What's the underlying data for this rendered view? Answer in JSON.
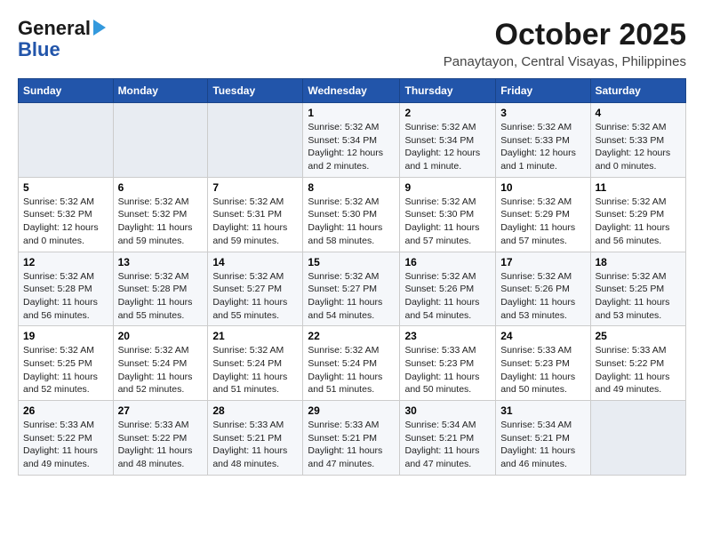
{
  "header": {
    "logo_line1": "General",
    "logo_line2": "Blue",
    "month": "October 2025",
    "location": "Panaytayon, Central Visayas, Philippines"
  },
  "days_of_week": [
    "Sunday",
    "Monday",
    "Tuesday",
    "Wednesday",
    "Thursday",
    "Friday",
    "Saturday"
  ],
  "weeks": [
    [
      {
        "day": "",
        "info": ""
      },
      {
        "day": "",
        "info": ""
      },
      {
        "day": "",
        "info": ""
      },
      {
        "day": "1",
        "info": "Sunrise: 5:32 AM\nSunset: 5:34 PM\nDaylight: 12 hours\nand 2 minutes."
      },
      {
        "day": "2",
        "info": "Sunrise: 5:32 AM\nSunset: 5:34 PM\nDaylight: 12 hours\nand 1 minute."
      },
      {
        "day": "3",
        "info": "Sunrise: 5:32 AM\nSunset: 5:33 PM\nDaylight: 12 hours\nand 1 minute."
      },
      {
        "day": "4",
        "info": "Sunrise: 5:32 AM\nSunset: 5:33 PM\nDaylight: 12 hours\nand 0 minutes."
      }
    ],
    [
      {
        "day": "5",
        "info": "Sunrise: 5:32 AM\nSunset: 5:32 PM\nDaylight: 12 hours\nand 0 minutes."
      },
      {
        "day": "6",
        "info": "Sunrise: 5:32 AM\nSunset: 5:32 PM\nDaylight: 11 hours\nand 59 minutes."
      },
      {
        "day": "7",
        "info": "Sunrise: 5:32 AM\nSunset: 5:31 PM\nDaylight: 11 hours\nand 59 minutes."
      },
      {
        "day": "8",
        "info": "Sunrise: 5:32 AM\nSunset: 5:30 PM\nDaylight: 11 hours\nand 58 minutes."
      },
      {
        "day": "9",
        "info": "Sunrise: 5:32 AM\nSunset: 5:30 PM\nDaylight: 11 hours\nand 57 minutes."
      },
      {
        "day": "10",
        "info": "Sunrise: 5:32 AM\nSunset: 5:29 PM\nDaylight: 11 hours\nand 57 minutes."
      },
      {
        "day": "11",
        "info": "Sunrise: 5:32 AM\nSunset: 5:29 PM\nDaylight: 11 hours\nand 56 minutes."
      }
    ],
    [
      {
        "day": "12",
        "info": "Sunrise: 5:32 AM\nSunset: 5:28 PM\nDaylight: 11 hours\nand 56 minutes."
      },
      {
        "day": "13",
        "info": "Sunrise: 5:32 AM\nSunset: 5:28 PM\nDaylight: 11 hours\nand 55 minutes."
      },
      {
        "day": "14",
        "info": "Sunrise: 5:32 AM\nSunset: 5:27 PM\nDaylight: 11 hours\nand 55 minutes."
      },
      {
        "day": "15",
        "info": "Sunrise: 5:32 AM\nSunset: 5:27 PM\nDaylight: 11 hours\nand 54 minutes."
      },
      {
        "day": "16",
        "info": "Sunrise: 5:32 AM\nSunset: 5:26 PM\nDaylight: 11 hours\nand 54 minutes."
      },
      {
        "day": "17",
        "info": "Sunrise: 5:32 AM\nSunset: 5:26 PM\nDaylight: 11 hours\nand 53 minutes."
      },
      {
        "day": "18",
        "info": "Sunrise: 5:32 AM\nSunset: 5:25 PM\nDaylight: 11 hours\nand 53 minutes."
      }
    ],
    [
      {
        "day": "19",
        "info": "Sunrise: 5:32 AM\nSunset: 5:25 PM\nDaylight: 11 hours\nand 52 minutes."
      },
      {
        "day": "20",
        "info": "Sunrise: 5:32 AM\nSunset: 5:24 PM\nDaylight: 11 hours\nand 52 minutes."
      },
      {
        "day": "21",
        "info": "Sunrise: 5:32 AM\nSunset: 5:24 PM\nDaylight: 11 hours\nand 51 minutes."
      },
      {
        "day": "22",
        "info": "Sunrise: 5:32 AM\nSunset: 5:24 PM\nDaylight: 11 hours\nand 51 minutes."
      },
      {
        "day": "23",
        "info": "Sunrise: 5:33 AM\nSunset: 5:23 PM\nDaylight: 11 hours\nand 50 minutes."
      },
      {
        "day": "24",
        "info": "Sunrise: 5:33 AM\nSunset: 5:23 PM\nDaylight: 11 hours\nand 50 minutes."
      },
      {
        "day": "25",
        "info": "Sunrise: 5:33 AM\nSunset: 5:22 PM\nDaylight: 11 hours\nand 49 minutes."
      }
    ],
    [
      {
        "day": "26",
        "info": "Sunrise: 5:33 AM\nSunset: 5:22 PM\nDaylight: 11 hours\nand 49 minutes."
      },
      {
        "day": "27",
        "info": "Sunrise: 5:33 AM\nSunset: 5:22 PM\nDaylight: 11 hours\nand 48 minutes."
      },
      {
        "day": "28",
        "info": "Sunrise: 5:33 AM\nSunset: 5:21 PM\nDaylight: 11 hours\nand 48 minutes."
      },
      {
        "day": "29",
        "info": "Sunrise: 5:33 AM\nSunset: 5:21 PM\nDaylight: 11 hours\nand 47 minutes."
      },
      {
        "day": "30",
        "info": "Sunrise: 5:34 AM\nSunset: 5:21 PM\nDaylight: 11 hours\nand 47 minutes."
      },
      {
        "day": "31",
        "info": "Sunrise: 5:34 AM\nSunset: 5:21 PM\nDaylight: 11 hours\nand 46 minutes."
      },
      {
        "day": "",
        "info": ""
      }
    ]
  ]
}
